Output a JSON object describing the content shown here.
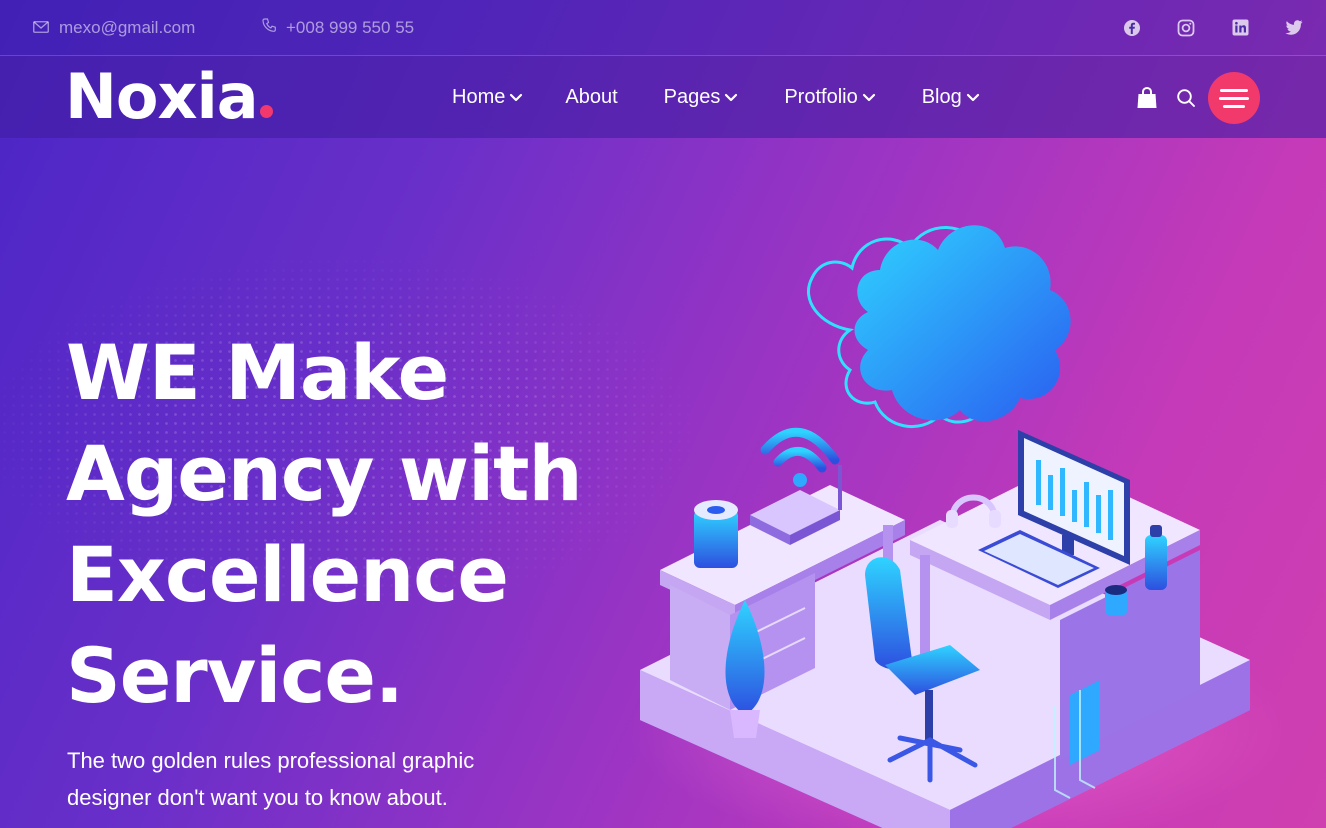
{
  "topbar": {
    "email": "mexo@gmail.com",
    "phone": "+008 999 550 55",
    "socials": [
      "facebook-icon",
      "instagram-icon",
      "linkedin-icon",
      "twitter-icon"
    ]
  },
  "nav": {
    "logo": "Noxia",
    "items": [
      {
        "label": "Home",
        "dropdown": true
      },
      {
        "label": "About",
        "dropdown": false
      },
      {
        "label": "Pages",
        "dropdown": true
      },
      {
        "label": "Protfolio",
        "dropdown": true
      },
      {
        "label": "Blog",
        "dropdown": true
      }
    ]
  },
  "hero": {
    "title_lines": [
      "WE Make",
      "Agency with",
      "Excellence",
      "Service."
    ],
    "subtitle_lines": [
      "The two golden rules professional graphic",
      "designer don't want you to know about."
    ]
  },
  "colors": {
    "accent": "#f2396c",
    "header_bg": "#3c1ea8",
    "gradient_start": "#4a25c6",
    "gradient_end": "#cf3fb0"
  }
}
